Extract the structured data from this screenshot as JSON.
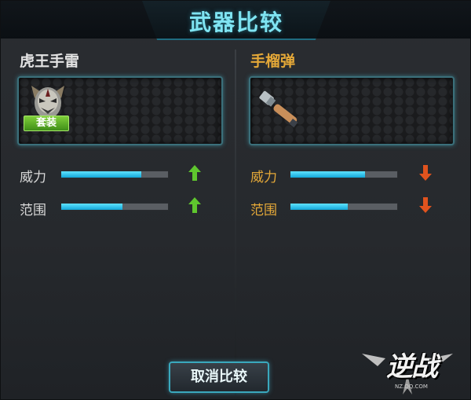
{
  "window": {
    "title": "武器比较"
  },
  "left": {
    "name": "虎王手雷",
    "badge": "套装",
    "stats": [
      {
        "label": "威力",
        "value": 0.75,
        "trend": "up"
      },
      {
        "label": "范围",
        "value": 0.57,
        "trend": "up"
      }
    ]
  },
  "right": {
    "name": "手榴弹",
    "stats": [
      {
        "label": "威力",
        "value": 0.7,
        "trend": "down"
      },
      {
        "label": "范围",
        "value": 0.54,
        "trend": "down"
      }
    ]
  },
  "actions": {
    "cancel_label": "取消比较"
  },
  "logo": {
    "main": "逆战",
    "sub": "NZ.QQ.COM"
  },
  "colors": {
    "accent": "#7fe4f2",
    "bar": "#13a7d8",
    "up": "#5fc62e",
    "down": "#e0531e",
    "right_label": "#e4a838"
  }
}
